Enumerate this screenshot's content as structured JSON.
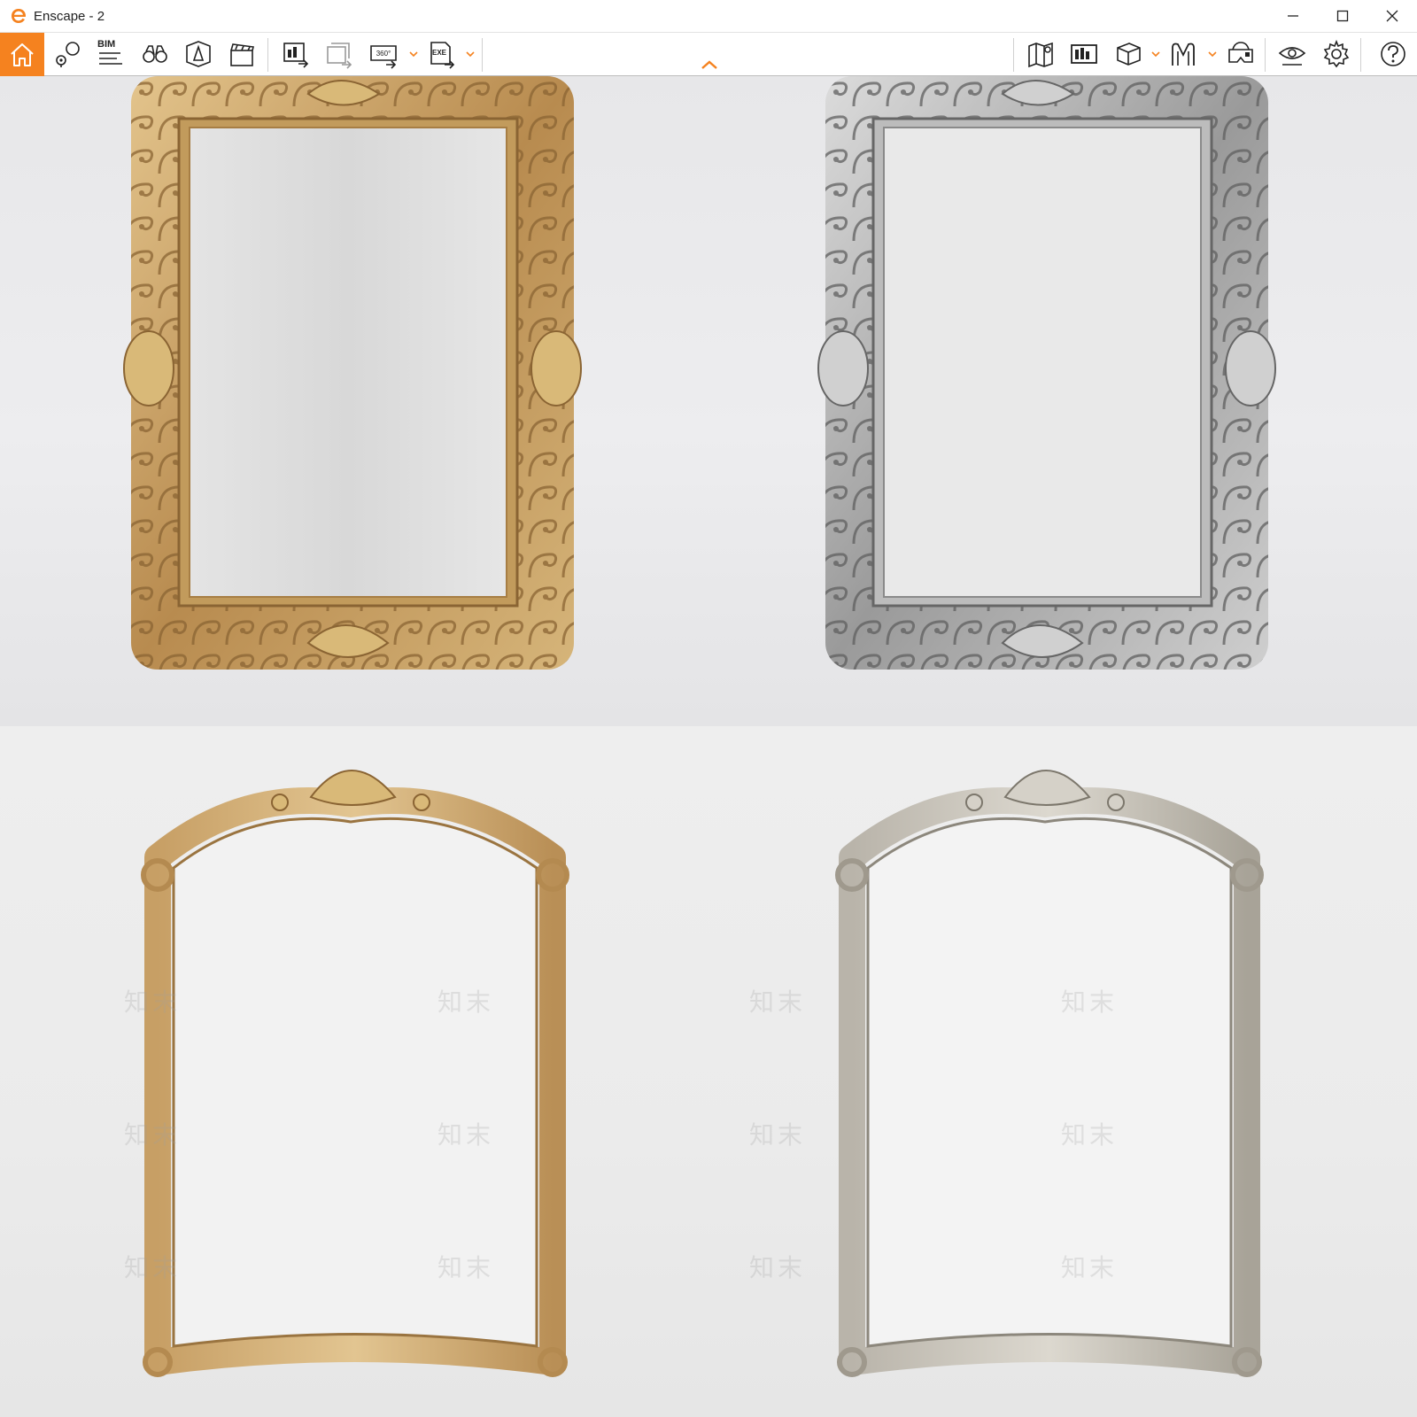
{
  "window": {
    "title": "Enscape - 2",
    "logo_icon": "enscape-logo-icon",
    "accent_color": "#f5821f",
    "controls": [
      "minimize-icon",
      "maximize-icon",
      "close-icon"
    ]
  },
  "toolbar": {
    "bim_label": "BIM",
    "left_tools": [
      {
        "name": "home",
        "icon": "home-icon",
        "active": true
      },
      {
        "name": "view-management",
        "icon": "map-pin-icon"
      },
      {
        "name": "bim-info",
        "icon": "bim-list-icon"
      },
      {
        "name": "explore",
        "icon": "binoculars-icon"
      },
      {
        "name": "orthographic",
        "icon": "perspective-icon"
      },
      {
        "name": "video-editor",
        "icon": "clapperboard-icon"
      },
      {
        "name": "render-image",
        "icon": "render-image-icon"
      },
      {
        "name": "batch-render",
        "icon": "batch-render-icon"
      },
      {
        "name": "panorama-360",
        "icon": "panorama-360-icon",
        "dropdown": true
      },
      {
        "name": "export-exe",
        "icon": "export-exe-icon",
        "dropdown": true
      }
    ],
    "right_tools": [
      {
        "name": "site-context",
        "icon": "map-icon"
      },
      {
        "name": "material-editor",
        "icon": "material-icon"
      },
      {
        "name": "asset-library",
        "icon": "cube-icon",
        "dropdown": true
      },
      {
        "name": "collaborative-annotations",
        "icon": "annotation-icon",
        "dropdown": true
      },
      {
        "name": "vr-headset",
        "icon": "vr-headset-icon"
      },
      {
        "name": "visual-settings",
        "icon": "eye-icon"
      },
      {
        "name": "general-settings",
        "icon": "gear-icon"
      },
      {
        "name": "help",
        "icon": "help-icon"
      }
    ],
    "collapse_icon": "chevron-up-icon"
  },
  "viewport": {
    "description_icons": [
      "baroque-frame-gold",
      "baroque-frame-silver",
      "arched-frame-gold",
      "arched-frame-silver"
    ],
    "frames": [
      {
        "style": "carved-rectangular",
        "finish": "gold",
        "color": "#c9a46a"
      },
      {
        "style": "carved-rectangular",
        "finish": "silver",
        "color": "#a9a9a9"
      },
      {
        "style": "arched-shell-crest",
        "finish": "gold",
        "color": "#c8a571"
      },
      {
        "style": "arched-shell-crest",
        "finish": "silver",
        "color": "#b5b0a6"
      }
    ],
    "watermark_text": "知末"
  }
}
